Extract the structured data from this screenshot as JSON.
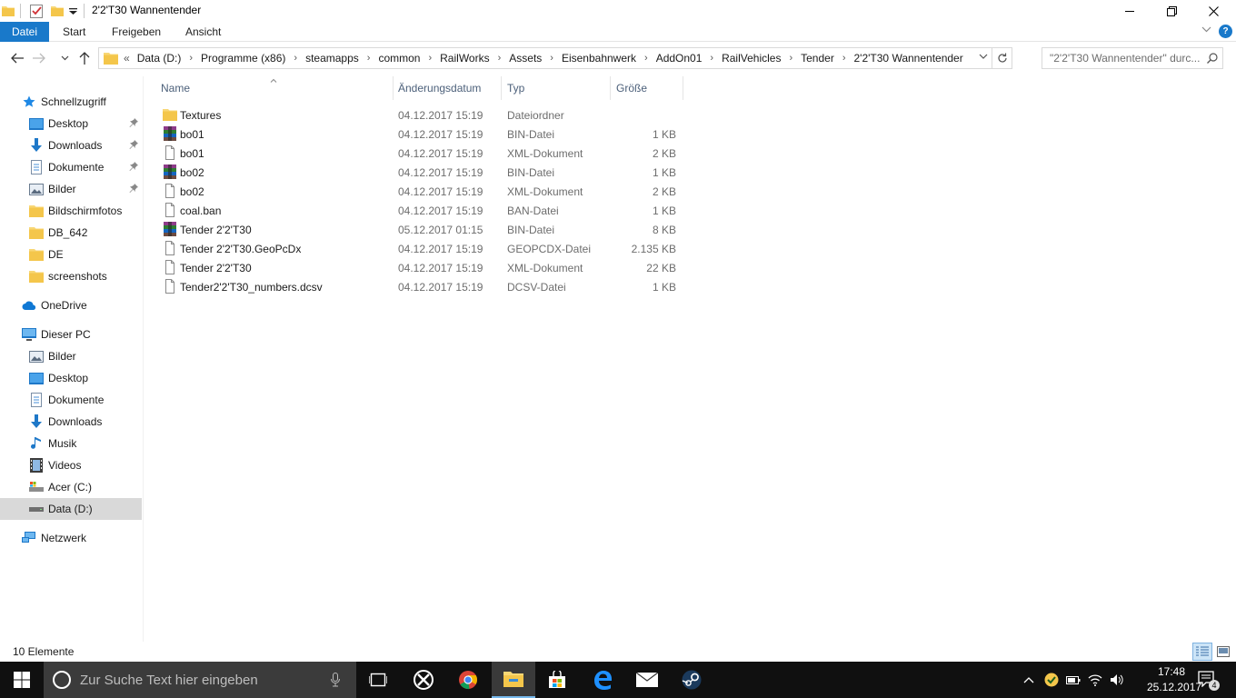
{
  "window": {
    "title": "2'2'T30 Wannentender",
    "minimize_label": "—",
    "maximize_label": "❐",
    "close_label": "✕"
  },
  "ribbon": {
    "tabs": [
      {
        "label": "Datei",
        "active": true
      },
      {
        "label": "Start"
      },
      {
        "label": "Freigeben"
      },
      {
        "label": "Ansicht"
      }
    ],
    "help_label": "?"
  },
  "address": {
    "overflow": "«",
    "crumbs": [
      "Data (D:)",
      "Programme (x86)",
      "steamapps",
      "common",
      "RailWorks",
      "Assets",
      "Eisenbahnwerk",
      "AddOn01",
      "RailVehicles",
      "Tender",
      "2'2'T30 Wannentender"
    ],
    "separator": "›"
  },
  "search": {
    "placeholder": "\"2'2'T30 Wannentender\" durc..."
  },
  "nav_pane": {
    "items": [
      {
        "label": "Schnellzugriff",
        "icon": "star-icon",
        "level": 0
      },
      {
        "label": "Desktop",
        "icon": "desktop-icon",
        "level": 1,
        "pinned": true
      },
      {
        "label": "Downloads",
        "icon": "download-icon",
        "level": 1,
        "pinned": true
      },
      {
        "label": "Dokumente",
        "icon": "document-icon",
        "level": 1,
        "pinned": true
      },
      {
        "label": "Bilder",
        "icon": "pictures-icon",
        "level": 1,
        "pinned": true
      },
      {
        "label": "Bildschirmfotos",
        "icon": "folder-icon",
        "level": 1
      },
      {
        "label": "DB_642",
        "icon": "folder-icon",
        "level": 1
      },
      {
        "label": "DE",
        "icon": "folder-icon",
        "level": 1
      },
      {
        "label": "screenshots",
        "icon": "folder-icon",
        "level": 1
      },
      {
        "label": "OneDrive",
        "icon": "onedrive-icon",
        "level": 0
      },
      {
        "label": "Dieser PC",
        "icon": "computer-icon",
        "level": 0
      },
      {
        "label": "Bilder",
        "icon": "pictures-icon",
        "level": 1
      },
      {
        "label": "Desktop",
        "icon": "desktop-icon",
        "level": 1
      },
      {
        "label": "Dokumente",
        "icon": "document-icon",
        "level": 1
      },
      {
        "label": "Downloads",
        "icon": "download-icon",
        "level": 1
      },
      {
        "label": "Musik",
        "icon": "music-icon",
        "level": 1
      },
      {
        "label": "Videos",
        "icon": "video-icon",
        "level": 1
      },
      {
        "label": "Acer (C:)",
        "icon": "drive-c-icon",
        "level": 1
      },
      {
        "label": "Data (D:)",
        "icon": "drive-icon",
        "level": 1,
        "selected": true
      },
      {
        "label": "Netzwerk",
        "icon": "network-icon",
        "level": 0
      }
    ]
  },
  "columns": {
    "name": "Name",
    "date": "Änderungsdatum",
    "type": "Typ",
    "size": "Größe"
  },
  "files": [
    {
      "name": "Textures",
      "date": "04.12.2017 15:19",
      "type": "Dateiordner",
      "size": "",
      "icon": "folder-icon"
    },
    {
      "name": "bo01",
      "date": "04.12.2017 15:19",
      "type": "BIN-Datei",
      "size": "1 KB",
      "icon": "archive-icon"
    },
    {
      "name": "bo01",
      "date": "04.12.2017 15:19",
      "type": "XML-Dokument",
      "size": "2 KB",
      "icon": "file-icon"
    },
    {
      "name": "bo02",
      "date": "04.12.2017 15:19",
      "type": "BIN-Datei",
      "size": "1 KB",
      "icon": "archive-icon"
    },
    {
      "name": "bo02",
      "date": "04.12.2017 15:19",
      "type": "XML-Dokument",
      "size": "2 KB",
      "icon": "file-icon"
    },
    {
      "name": "coal.ban",
      "date": "04.12.2017 15:19",
      "type": "BAN-Datei",
      "size": "1 KB",
      "icon": "file-icon"
    },
    {
      "name": "Tender 2'2'T30",
      "date": "05.12.2017 01:15",
      "type": "BIN-Datei",
      "size": "8 KB",
      "icon": "archive-icon"
    },
    {
      "name": "Tender 2'2'T30.GeoPcDx",
      "date": "04.12.2017 15:19",
      "type": "GEOPCDX-Datei",
      "size": "2.135 KB",
      "icon": "file-icon"
    },
    {
      "name": "Tender 2'2'T30",
      "date": "04.12.2017 15:19",
      "type": "XML-Dokument",
      "size": "22 KB",
      "icon": "file-icon"
    },
    {
      "name": "Tender2'2'T30_numbers.dcsv",
      "date": "04.12.2017 15:19",
      "type": "DCSV-Datei",
      "size": "1 KB",
      "icon": "file-icon"
    }
  ],
  "status": {
    "count": "10 Elemente"
  },
  "taskbar": {
    "search_placeholder": "Zur Suche Text hier eingeben",
    "apps": [
      "task-view-icon",
      "xbox-icon",
      "chrome-icon",
      "file-explorer-icon",
      "store-icon",
      "edge-icon",
      "mail-icon",
      "steam-icon"
    ],
    "clock_time": "17:48",
    "clock_date": "25.12.2017",
    "notification_count": "4"
  },
  "colors": {
    "accent": "#1979ca",
    "folder": "#f8d775",
    "taskbar": "#101010",
    "selected_nav": "#d9d9d9",
    "header_text": "#4c607a"
  }
}
